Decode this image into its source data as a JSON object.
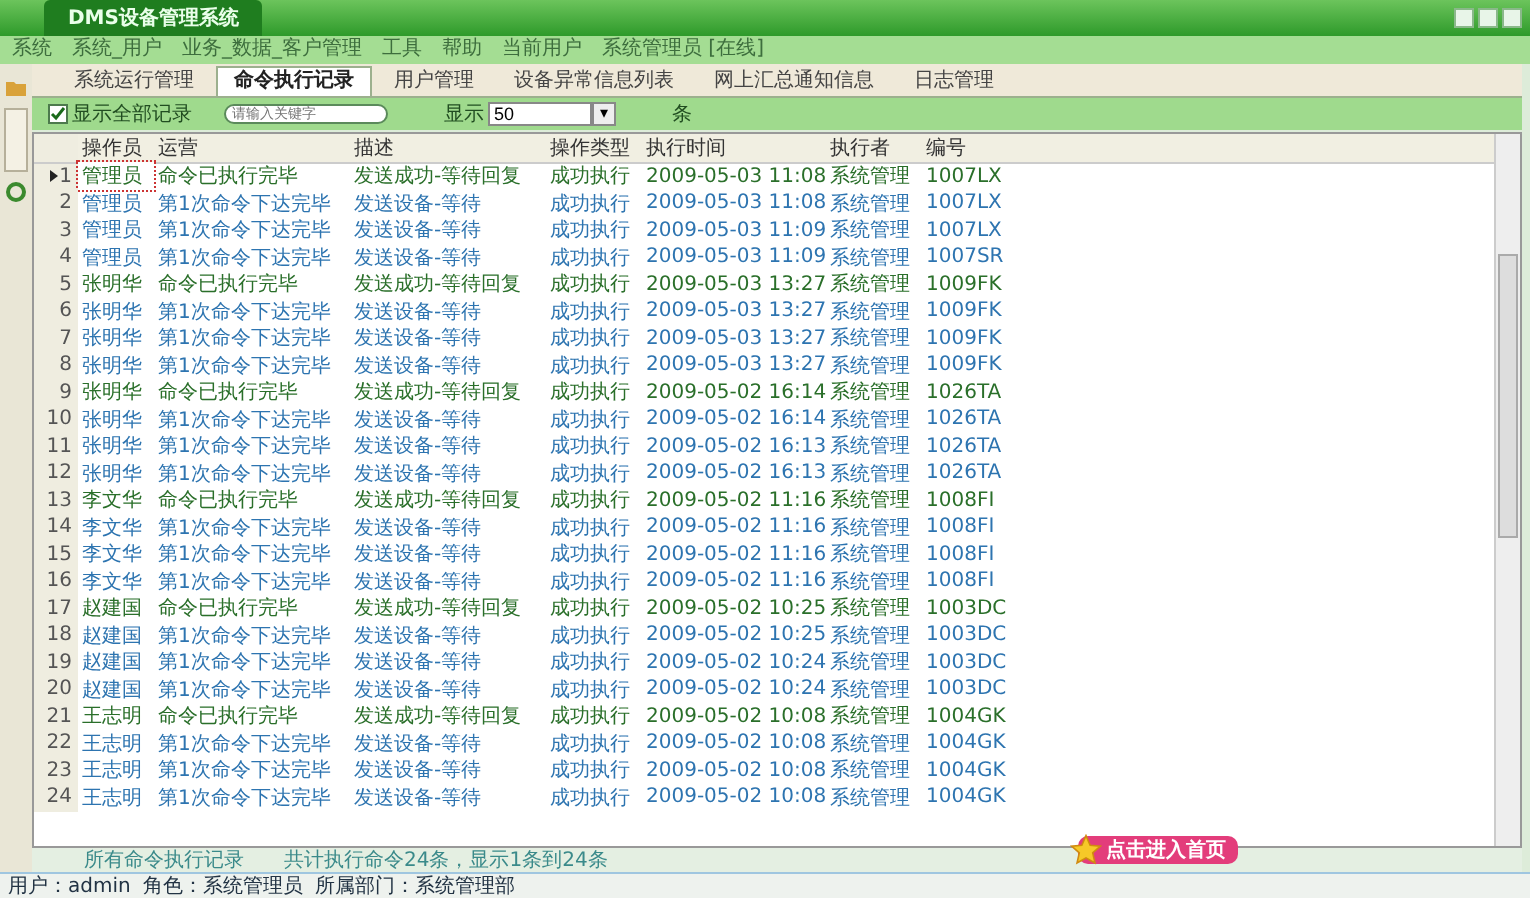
{
  "window": {
    "title": "DMS设备管理系统"
  },
  "menu": [
    "系统",
    "系统_用户",
    "业务_数据_客户管理",
    "工具",
    "帮助",
    "当前用户",
    "系统管理员 [在线]"
  ],
  "tabs": [
    {
      "label": "系统运行管理",
      "selected": false
    },
    {
      "label": "命令执行记录",
      "selected": true
    },
    {
      "label": "用户管理",
      "selected": false
    },
    {
      "label": "设备异常信息列表",
      "selected": false
    },
    {
      "label": "网上汇总通知信息",
      "selected": false
    },
    {
      "label": "日志管理",
      "selected": false
    }
  ],
  "toolbar": {
    "show_all": {
      "label": "显示全部记录",
      "checked": true
    },
    "filter": {
      "placeholder": "请输入关键字"
    },
    "page_size_label": "显示",
    "page_size": "50",
    "dropdown": "▾",
    "unit": "条"
  },
  "table": {
    "columns": [
      "操作员",
      "运营",
      "描述",
      "操作类型",
      "执行时间",
      "执行者",
      "编号"
    ],
    "rows": [
      {
        "num": "1",
        "selected": true,
        "kind": "done",
        "cells": [
          "管理员",
          "命令已执行完毕",
          "发送成功-等待回复",
          "成功执行",
          "2009-05-03 11:08",
          "系统管理",
          "1007LX"
        ]
      },
      {
        "num": "2",
        "selected": false,
        "kind": "sent",
        "cells": [
          "管理员",
          "第1次命令下达完毕",
          "发送设备-等待",
          "成功执行",
          "2009-05-03 11:08",
          "系统管理",
          "1007LX"
        ]
      },
      {
        "num": "3",
        "selected": false,
        "kind": "sent",
        "cells": [
          "管理员",
          "第1次命令下达完毕",
          "发送设备-等待",
          "成功执行",
          "2009-05-03 11:09",
          "系统管理",
          "1007LX"
        ]
      },
      {
        "num": "4",
        "selected": false,
        "kind": "sent",
        "cells": [
          "管理员",
          "第1次命令下达完毕",
          "发送设备-等待",
          "成功执行",
          "2009-05-03 11:09",
          "系统管理",
          "1007SR"
        ]
      },
      {
        "num": "5",
        "selected": false,
        "kind": "done",
        "cells": [
          "张明华",
          "命令已执行完毕",
          "发送成功-等待回复",
          "成功执行",
          "2009-05-03 13:27",
          "系统管理",
          "1009FK"
        ]
      },
      {
        "num": "6",
        "selected": false,
        "kind": "sent",
        "cells": [
          "张明华",
          "第1次命令下达完毕",
          "发送设备-等待",
          "成功执行",
          "2009-05-03 13:27",
          "系统管理",
          "1009FK"
        ]
      },
      {
        "num": "7",
        "selected": false,
        "kind": "sent",
        "cells": [
          "张明华",
          "第1次命令下达完毕",
          "发送设备-等待",
          "成功执行",
          "2009-05-03 13:27",
          "系统管理",
          "1009FK"
        ]
      },
      {
        "num": "8",
        "selected": false,
        "kind": "sent",
        "cells": [
          "张明华",
          "第1次命令下达完毕",
          "发送设备-等待",
          "成功执行",
          "2009-05-03 13:27",
          "系统管理",
          "1009FK"
        ]
      },
      {
        "num": "9",
        "selected": false,
        "kind": "done",
        "cells": [
          "张明华",
          "命令已执行完毕",
          "发送成功-等待回复",
          "成功执行",
          "2009-05-02 16:14",
          "系统管理",
          "1026TA"
        ]
      },
      {
        "num": "10",
        "selected": false,
        "kind": "sent",
        "cells": [
          "张明华",
          "第1次命令下达完毕",
          "发送设备-等待",
          "成功执行",
          "2009-05-02 16:14",
          "系统管理",
          "1026TA"
        ]
      },
      {
        "num": "11",
        "selected": false,
        "kind": "sent",
        "cells": [
          "张明华",
          "第1次命令下达完毕",
          "发送设备-等待",
          "成功执行",
          "2009-05-02 16:13",
          "系统管理",
          "1026TA"
        ]
      },
      {
        "num": "12",
        "selected": false,
        "kind": "sent",
        "cells": [
          "张明华",
          "第1次命令下达完毕",
          "发送设备-等待",
          "成功执行",
          "2009-05-02 16:13",
          "系统管理",
          "1026TA"
        ]
      },
      {
        "num": "13",
        "selected": false,
        "kind": "done",
        "cells": [
          "李文华",
          "命令已执行完毕",
          "发送成功-等待回复",
          "成功执行",
          "2009-05-02 11:16",
          "系统管理",
          "1008FI"
        ]
      },
      {
        "num": "14",
        "selected": false,
        "kind": "sent",
        "cells": [
          "李文华",
          "第1次命令下达完毕",
          "发送设备-等待",
          "成功执行",
          "2009-05-02 11:16",
          "系统管理",
          "1008FI"
        ]
      },
      {
        "num": "15",
        "selected": false,
        "kind": "sent",
        "cells": [
          "李文华",
          "第1次命令下达完毕",
          "发送设备-等待",
          "成功执行",
          "2009-05-02 11:16",
          "系统管理",
          "1008FI"
        ]
      },
      {
        "num": "16",
        "selected": false,
        "kind": "sent",
        "cells": [
          "李文华",
          "第1次命令下达完毕",
          "发送设备-等待",
          "成功执行",
          "2009-05-02 11:16",
          "系统管理",
          "1008FI"
        ]
      },
      {
        "num": "17",
        "selected": false,
        "kind": "done",
        "cells": [
          "赵建国",
          "命令已执行完毕",
          "发送成功-等待回复",
          "成功执行",
          "2009-05-02 10:25",
          "系统管理",
          "1003DC"
        ]
      },
      {
        "num": "18",
        "selected": false,
        "kind": "sent",
        "cells": [
          "赵建国",
          "第1次命令下达完毕",
          "发送设备-等待",
          "成功执行",
          "2009-05-02 10:25",
          "系统管理",
          "1003DC"
        ]
      },
      {
        "num": "19",
        "selected": false,
        "kind": "sent",
        "cells": [
          "赵建国",
          "第1次命令下达完毕",
          "发送设备-等待",
          "成功执行",
          "2009-05-02 10:24",
          "系统管理",
          "1003DC"
        ]
      },
      {
        "num": "20",
        "selected": false,
        "kind": "sent",
        "cells": [
          "赵建国",
          "第1次命令下达完毕",
          "发送设备-等待",
          "成功执行",
          "2009-05-02 10:24",
          "系统管理",
          "1003DC"
        ]
      },
      {
        "num": "21",
        "selected": false,
        "kind": "done",
        "cells": [
          "王志明",
          "命令已执行完毕",
          "发送成功-等待回复",
          "成功执行",
          "2009-05-02 10:08",
          "系统管理",
          "1004GK"
        ]
      },
      {
        "num": "22",
        "selected": false,
        "kind": "sent",
        "cells": [
          "王志明",
          "第1次命令下达完毕",
          "发送设备-等待",
          "成功执行",
          "2009-05-02 10:08",
          "系统管理",
          "1004GK"
        ]
      },
      {
        "num": "23",
        "selected": false,
        "kind": "sent",
        "cells": [
          "王志明",
          "第1次命令下达完毕",
          "发送设备-等待",
          "成功执行",
          "2009-05-02 10:08",
          "系统管理",
          "1004GK"
        ]
      },
      {
        "num": "24",
        "selected": false,
        "kind": "sent",
        "cells": [
          "王志明",
          "第1次命令下达完毕",
          "发送设备-等待",
          "成功执行",
          "2009-05-02 10:08",
          "系统管理",
          "1004GK"
        ]
      }
    ]
  },
  "summary": [
    "所有命令执行记录",
    "共计执行命令24条，显示1条到24条"
  ],
  "status_bar": [
    "用户：admin",
    "角色：系统管理员",
    "所属部门：系统管理部"
  ],
  "badge": {
    "label": "点击进入首页"
  }
}
